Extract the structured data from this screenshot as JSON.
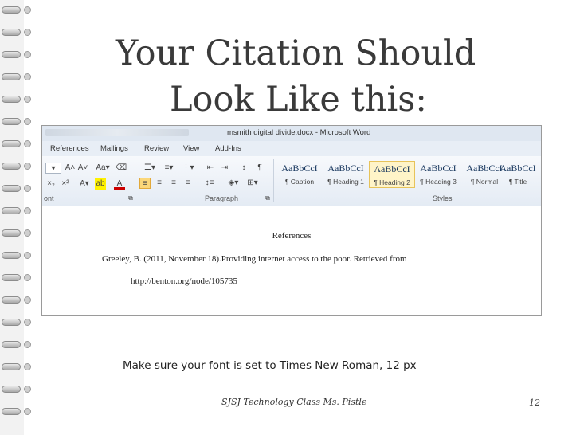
{
  "slide": {
    "title_line1": "Your Citation Should",
    "title_line2": "Look Like this:",
    "caption": "Make sure your font is set to Times New Roman, 12 px",
    "footer": "SJSJ Technology Class Ms. Pistle",
    "page_number": "12"
  },
  "word": {
    "window_title": "msmith digital divide.docx - Microsoft Word",
    "tabs": [
      "References",
      "Mailings",
      "Review",
      "View",
      "Add-Ins"
    ],
    "ribbon": {
      "font_group_label": "ont",
      "paragraph_group_label": "Paragraph",
      "styles_group_label": "Styles",
      "styles": [
        {
          "sample": "AaBbCcI",
          "name": "¶ Caption"
        },
        {
          "sample": "AaBbCcI",
          "name": "¶ Heading 1"
        },
        {
          "sample": "AaBbCcI",
          "name": "¶ Heading 2"
        },
        {
          "sample": "AaBbCcI",
          "name": "¶ Heading 3"
        },
        {
          "sample": "AaBbCcI",
          "name": "¶ Normal"
        },
        {
          "sample": "AaBbCcI",
          "name": "¶ Title"
        }
      ]
    },
    "document": {
      "heading": "References",
      "line1": "Greeley, B. (2011, November 18).Providing internet access to the poor. Retrieved from",
      "line2": "http://benton.org/node/105735"
    }
  }
}
